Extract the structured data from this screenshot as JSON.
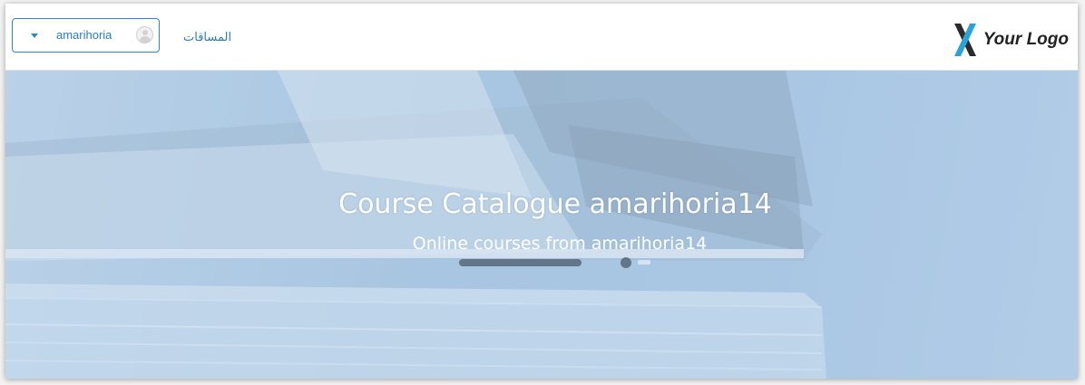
{
  "header": {
    "user_menu": {
      "username": "amarihoria"
    },
    "nav_link": "المساقات",
    "logo_text": "Your Logo",
    "logo_colors": {
      "primary": "#2aa3d8",
      "secondary": "#2b2b2b"
    }
  },
  "hero": {
    "title": "Course Catalogue amarihoria14",
    "subtitle": "Online courses from amarihoria14"
  },
  "colors": {
    "accent": "#2a8bc4",
    "hero_overlay": "#a8c5e0"
  }
}
